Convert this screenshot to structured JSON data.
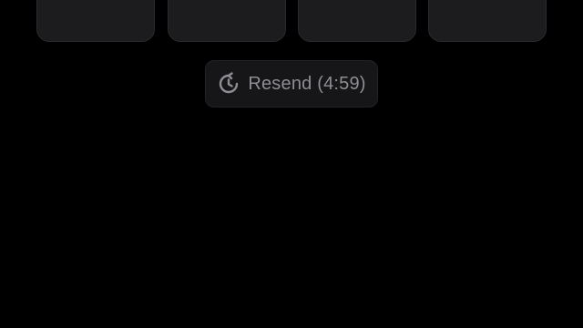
{
  "verification": {
    "code_boxes": [
      "",
      "",
      "",
      ""
    ]
  },
  "resend": {
    "label": "Resend (4:59)",
    "icon": "clock-refresh-icon"
  },
  "colors": {
    "background": "#000000",
    "box_fill": "#1c1c1e",
    "button_fill": "#161618",
    "text_muted": "#8e8e93"
  }
}
